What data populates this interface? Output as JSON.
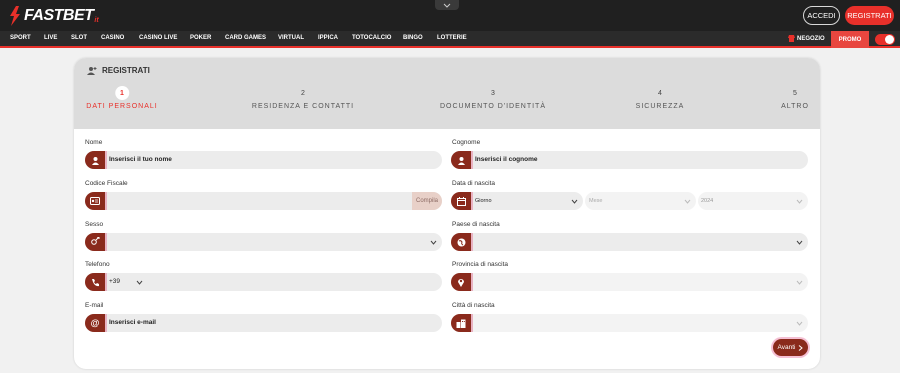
{
  "header": {
    "logo_text": "FASTBET",
    "logo_suffix": "it",
    "login_label": "ACCEDI",
    "register_label": "REGISTRATI"
  },
  "nav": {
    "items": [
      "SPORT",
      "LIVE",
      "SLOT",
      "CASINO",
      "CASINO LIVE",
      "POKER",
      "CARD GAMES",
      "VIRTUAL",
      "IPPICA",
      "TOTOCALCIO",
      "BINGO",
      "LOTTERIE"
    ],
    "shop_label": "NEGOZIO",
    "promo_label": "PROMO"
  },
  "form": {
    "title": "REGISTRATI",
    "steps": [
      {
        "num": "1",
        "label": "DATI PERSONALI"
      },
      {
        "num": "2",
        "label": "RESIDENZA E CONTATTI"
      },
      {
        "num": "3",
        "label": "DOCUMENTO D'IDENTITÀ"
      },
      {
        "num": "4",
        "label": "SICUREZZA"
      },
      {
        "num": "5",
        "label": "ALTRO"
      }
    ],
    "active_step": 1,
    "fields": {
      "nome": {
        "label": "Nome",
        "placeholder": "Inserisci il tuo nome"
      },
      "cognome": {
        "label": "Cognome",
        "placeholder": "Inserisci il cognome"
      },
      "codice_fiscale": {
        "label": "Codice Fiscale",
        "action": "Compila"
      },
      "data_nascita": {
        "label": "Data di nascita",
        "day": "Giorno",
        "month": "Mese",
        "year": "2024"
      },
      "sesso": {
        "label": "Sesso"
      },
      "paese_nascita": {
        "label": "Paese di nascita"
      },
      "telefono": {
        "label": "Telefono",
        "prefix": "+39"
      },
      "provincia_nascita": {
        "label": "Provincia di nascita"
      },
      "email": {
        "label": "E-mail",
        "placeholder": "Inserisci e-mail"
      },
      "citta_nascita": {
        "label": "Città di nascita"
      }
    },
    "next_label": "Avanti"
  },
  "colors": {
    "brand_red": "#e8302a",
    "icon_brown": "#8a2a1c",
    "dark_bg": "#202020"
  }
}
